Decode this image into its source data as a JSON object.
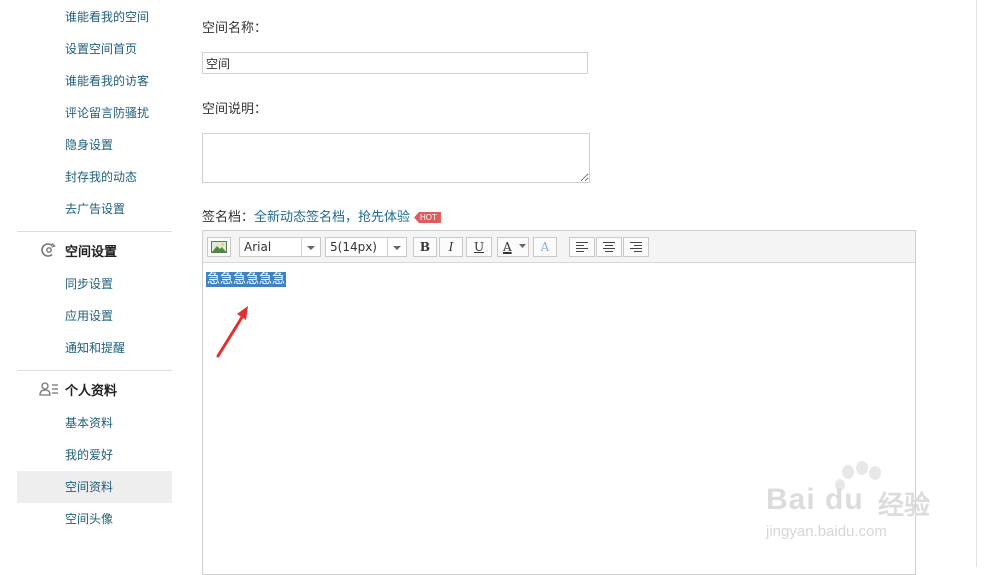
{
  "sidebar": {
    "items_top": [
      {
        "label": "谁能看我的空间"
      },
      {
        "label": "设置空间首页"
      },
      {
        "label": "谁能看我的访客"
      },
      {
        "label": "评论留言防骚扰"
      },
      {
        "label": "隐身设置"
      },
      {
        "label": "封存我的动态"
      },
      {
        "label": "去广告设置"
      }
    ],
    "section_space": {
      "title": "空间设置",
      "icon": "sync-gear-icon",
      "items": [
        {
          "label": "同步设置"
        },
        {
          "label": "应用设置"
        },
        {
          "label": "通知和提醒"
        }
      ]
    },
    "section_profile": {
      "title": "个人资料",
      "icon": "user-card-icon",
      "items": [
        {
          "label": "基本资料"
        },
        {
          "label": "我的爱好"
        },
        {
          "label": "空间资料",
          "active": true
        },
        {
          "label": "空间头像"
        }
      ]
    }
  },
  "form": {
    "name_label": "空间名称：",
    "name_value": "空间",
    "desc_label": "空间说明：",
    "desc_value": "",
    "sig_label": "签名档：",
    "sig_link": "全新动态签名档，抢先体验",
    "hot_badge": "HOT"
  },
  "editor": {
    "font_family": "Arial",
    "font_size": "5(14px)",
    "bold": "B",
    "italic": "I",
    "underline": "U",
    "font_color_label": "A",
    "highlight_label": "A",
    "content": "急急急急急急"
  },
  "watermark": {
    "logo_text": "Bai du",
    "logo_cn": "经验",
    "url": "jingyan.baidu.com"
  },
  "colors": {
    "link": "#1f5f7a",
    "selection": "#3f83c2",
    "hot": "#e15b5b",
    "arrow": "#e2302f"
  }
}
